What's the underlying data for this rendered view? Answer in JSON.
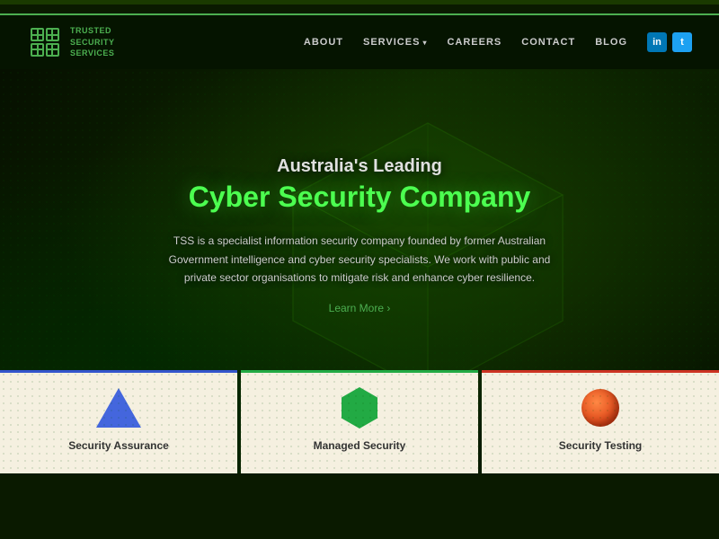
{
  "topBar": {},
  "accentLine": {},
  "header": {
    "logo": {
      "text": "TRUSTED\nSECURITY\nSERVICES"
    },
    "nav": {
      "items": [
        {
          "id": "about",
          "label": "ABOUT"
        },
        {
          "id": "services",
          "label": "SERVICES",
          "hasDropdown": true
        },
        {
          "id": "careers",
          "label": "CAREERS"
        },
        {
          "id": "contact",
          "label": "CONTACT"
        },
        {
          "id": "blog",
          "label": "BLOG"
        }
      ],
      "social": [
        {
          "id": "linkedin",
          "label": "in",
          "type": "linkedin"
        },
        {
          "id": "twitter",
          "label": "t",
          "type": "twitter"
        }
      ]
    }
  },
  "hero": {
    "subtitle": "Australia's Leading",
    "title": "Cyber Security Company",
    "description": "TSS is a specialist information security company founded by former Australian Government intelligence and cyber security specialists. We work with public and private sector organisations to mitigate risk and enhance cyber resilience.",
    "cta": "Learn More ›"
  },
  "cards": [
    {
      "id": "security-assurance",
      "label": "Security Assurance",
      "icon": "triangle",
      "color": "#4466dd"
    },
    {
      "id": "managed-security",
      "label": "Managed Security",
      "icon": "hexagon",
      "color": "#22aa44"
    },
    {
      "id": "security-testing",
      "label": "Security Testing",
      "icon": "circle",
      "color": "#cc2200"
    }
  ]
}
